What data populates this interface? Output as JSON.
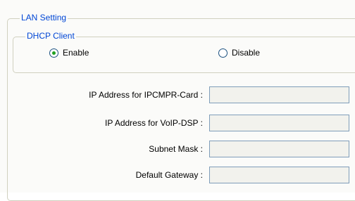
{
  "lan_setting": {
    "title": "LAN Setting"
  },
  "dhcp_client": {
    "title": "DHCP Client",
    "options": [
      {
        "label": "Enable",
        "selected": true
      },
      {
        "label": "Disable",
        "selected": false
      }
    ]
  },
  "fields": [
    {
      "label": "IP Address for IPCMPR-Card :",
      "value": ""
    },
    {
      "label": "IP Address for VoIP-DSP :",
      "value": ""
    },
    {
      "label": "Subnet Mask :",
      "value": ""
    },
    {
      "label": "Default Gateway :",
      "value": ""
    }
  ],
  "colors": {
    "legend_text": "#0046d5",
    "group_border": "#d0d0bf",
    "input_border": "#7f9db9",
    "input_background": "#f2f2ed",
    "radio_selected": "#21a121",
    "panel_background": "#fbfbf9"
  }
}
